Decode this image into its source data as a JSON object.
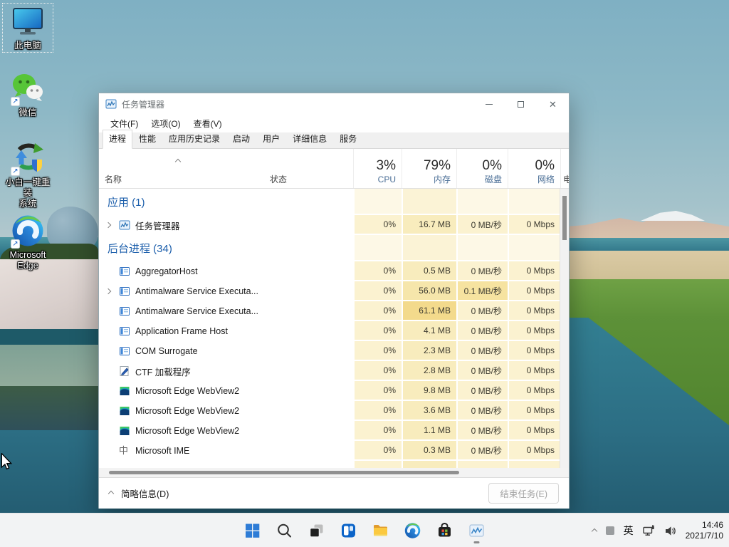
{
  "desktop": {
    "icons": [
      {
        "label": "此电脑",
        "label2": "",
        "icon": "this-pc-icon",
        "selected": true,
        "shortcut": false
      },
      {
        "label": "微信",
        "label2": "",
        "icon": "wechat-icon",
        "selected": false,
        "shortcut": true
      },
      {
        "label": "小白一键重装",
        "label2": "系统",
        "icon": "xiaobai-reinstall-icon",
        "selected": false,
        "shortcut": true
      },
      {
        "label": "Microsoft",
        "label2": "Edge",
        "icon": "edge-icon",
        "selected": false,
        "shortcut": true
      }
    ],
    "shortcut_glyph": "↗",
    "wallpaper_colors": {
      "sky": "#8fb6c5",
      "water": "#2e7689",
      "grass": "#679a3e",
      "mountain": "#cbb0a0"
    }
  },
  "taskmanager": {
    "title": "任务管理器",
    "menus": [
      {
        "label": "文件(F)"
      },
      {
        "label": "选项(O)"
      },
      {
        "label": "查看(V)"
      }
    ],
    "tabs": [
      {
        "label": "进程",
        "active": true
      },
      {
        "label": "性能",
        "active": false
      },
      {
        "label": "应用历史记录",
        "active": false
      },
      {
        "label": "启动",
        "active": false
      },
      {
        "label": "用户",
        "active": false
      },
      {
        "label": "详细信息",
        "active": false
      },
      {
        "label": "服务",
        "active": false
      }
    ],
    "columns": {
      "name": "名称",
      "status": "状态",
      "cpu_pct": "3%",
      "cpu": "CPU",
      "mem_pct": "79%",
      "mem": "内存",
      "disk_pct": "0%",
      "disk": "磁盘",
      "net_pct": "0%",
      "net": "网络",
      "power": "电"
    },
    "rows": [
      {
        "type": "group",
        "name": "应用 (1)"
      },
      {
        "type": "process",
        "name": "任务管理器",
        "icon": "task-manager-icon",
        "expand": true,
        "cpu": "0%",
        "mem": "16.7 MB",
        "disk": "0 MB/秒",
        "net": "0 Mbps",
        "mem_l": 1,
        "disk_l": 1
      },
      {
        "type": "group",
        "name": "后台进程 (34)"
      },
      {
        "type": "process",
        "name": "AggregatorHost",
        "icon": "app-window-icon",
        "expand": false,
        "cpu": "0%",
        "mem": "0.5 MB",
        "disk": "0 MB/秒",
        "net": "0 Mbps",
        "mem_l": 1,
        "disk_l": 1
      },
      {
        "type": "process",
        "name": "Antimalware Service Executa...",
        "icon": "app-window-icon",
        "expand": true,
        "cpu": "0%",
        "mem": "56.0 MB",
        "disk": "0.1 MB/秒",
        "net": "0 Mbps",
        "mem_l": 2,
        "disk_l": 2
      },
      {
        "type": "process",
        "name": "Antimalware Service Executa...",
        "icon": "app-window-icon",
        "expand": false,
        "cpu": "0%",
        "mem": "61.1 MB",
        "disk": "0 MB/秒",
        "net": "0 Mbps",
        "mem_l": 3,
        "disk_l": 1
      },
      {
        "type": "process",
        "name": "Application Frame Host",
        "icon": "app-window-icon",
        "expand": false,
        "cpu": "0%",
        "mem": "4.1 MB",
        "disk": "0 MB/秒",
        "net": "0 Mbps",
        "mem_l": 1,
        "disk_l": 1
      },
      {
        "type": "process",
        "name": "COM Surrogate",
        "icon": "app-window-icon",
        "expand": false,
        "cpu": "0%",
        "mem": "2.3 MB",
        "disk": "0 MB/秒",
        "net": "0 Mbps",
        "mem_l": 1,
        "disk_l": 1
      },
      {
        "type": "process",
        "name": "CTF 加载程序",
        "icon": "ctf-loader-icon",
        "expand": false,
        "cpu": "0%",
        "mem": "2.8 MB",
        "disk": "0 MB/秒",
        "net": "0 Mbps",
        "mem_l": 1,
        "disk_l": 1
      },
      {
        "type": "process",
        "name": "Microsoft Edge WebView2",
        "icon": "edge-webview-icon",
        "expand": false,
        "cpu": "0%",
        "mem": "9.8 MB",
        "disk": "0 MB/秒",
        "net": "0 Mbps",
        "mem_l": 1,
        "disk_l": 1
      },
      {
        "type": "process",
        "name": "Microsoft Edge WebView2",
        "icon": "edge-webview-icon",
        "expand": false,
        "cpu": "0%",
        "mem": "3.6 MB",
        "disk": "0 MB/秒",
        "net": "0 Mbps",
        "mem_l": 1,
        "disk_l": 1
      },
      {
        "type": "process",
        "name": "Microsoft Edge WebView2",
        "icon": "edge-webview-icon",
        "expand": false,
        "cpu": "0%",
        "mem": "1.1 MB",
        "disk": "0 MB/秒",
        "net": "0 Mbps",
        "mem_l": 1,
        "disk_l": 1
      },
      {
        "type": "process",
        "name": "Microsoft IME",
        "icon": "ime-icon",
        "expand": false,
        "cpu": "0%",
        "mem": "0.3 MB",
        "disk": "0 MB/秒",
        "net": "0 Mbps",
        "mem_l": 1,
        "disk_l": 1
      },
      {
        "type": "partial"
      }
    ],
    "footer": {
      "details_toggle": "简略信息(D)",
      "end_task": "结束任务(E)"
    }
  },
  "taskbar": {
    "items": [
      {
        "name": "start",
        "icon": "start-icon"
      },
      {
        "name": "search",
        "icon": "search-icon"
      },
      {
        "name": "task-view",
        "icon": "task-view-icon"
      },
      {
        "name": "widgets",
        "icon": "widgets-icon"
      },
      {
        "name": "file-explorer",
        "icon": "folder-icon"
      },
      {
        "name": "edge",
        "icon": "edge-icon"
      },
      {
        "name": "store",
        "icon": "store-icon"
      },
      {
        "name": "task-manager",
        "icon": "task-manager-icon",
        "running": true
      }
    ],
    "tray": {
      "ime": "英",
      "time": "14:46",
      "date": "2021/7/10"
    }
  }
}
